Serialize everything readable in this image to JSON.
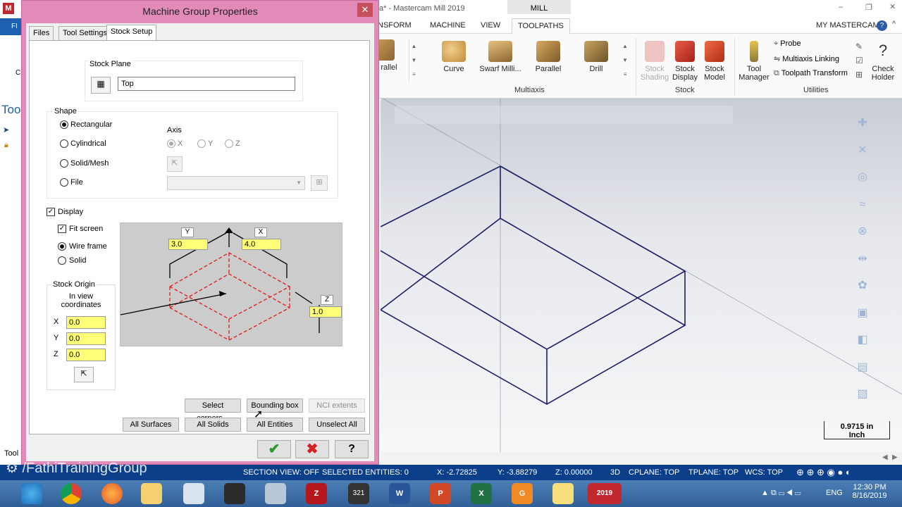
{
  "app": {
    "title_partial": "a* - Mastercam Mill 2019",
    "context_tab": "MILL",
    "my_mastercam": "MY MASTERCAM",
    "ribbon_tabs": [
      "NSFORM",
      "MACHINE",
      "VIEW",
      "TOOLPATHS"
    ],
    "active_ribbon_tab": "TOOLPATHS",
    "ribbon": {
      "partial_left": "rallel",
      "multiaxis": [
        "Curve",
        "Swarf Milli...",
        "Parallel",
        "Drill"
      ],
      "multiaxis_group": "Multiaxis",
      "stock_shading": "Stock\nShading",
      "stock_display": "Stock\nDisplay",
      "stock_model": "Stock\nModel",
      "stock_group": "Stock",
      "tool_manager": "Tool\nManager",
      "probe": "Probe",
      "multiaxis_linking": "Multiaxis Linking",
      "toolpath_transform": "Toolpath Transform",
      "check_holder": "Check\nHolder",
      "utilities_group": "Utilities"
    },
    "left_strip": {
      "fi": "FI",
      "too": "Too",
      "c": "C",
      "tool": "Tool"
    },
    "scale": {
      "value": "0.9715 in",
      "unit": "Inch"
    },
    "colors": {
      "wire": "#1a1f6b",
      "status": "#0b3f8a",
      "dialog_frame": "#e28bb9"
    }
  },
  "dialog": {
    "title": "Machine Group Properties",
    "tabs": [
      "Files",
      "Tool Settings",
      "Stock Setup"
    ],
    "active_tab": "Stock Setup",
    "stock_plane": {
      "label": "Stock Plane",
      "value": "Top"
    },
    "shape": {
      "label": "Shape",
      "options": [
        "Rectangular",
        "Cylindrical",
        "Solid/Mesh",
        "File"
      ],
      "selected": "Rectangular",
      "axis_label": "Axis",
      "axes": [
        "X",
        "Y",
        "Z"
      ],
      "axis_selected": "X"
    },
    "display": {
      "label": "Display",
      "checked": true,
      "fit_screen": "Fit screen",
      "fit_checked": true,
      "wire_frame": "Wire frame",
      "solid": "Solid",
      "selected": "Wire frame"
    },
    "stock_origin": {
      "label": "Stock Origin",
      "sub": "In view coordinates",
      "x_label": "X",
      "y_label": "Y",
      "z_label": "Z",
      "x": "0.0",
      "y": "0.0",
      "z": "0.0"
    },
    "dimensions": {
      "y_label": "Y",
      "x_label": "X",
      "z_label": "Z",
      "y": "3.0",
      "x": "4.0",
      "z": "1.0"
    },
    "buttons": {
      "select_corners": "Select corners...",
      "bounding_box": "Bounding box",
      "nci_extents": "NCI extents",
      "all_surfaces": "All Surfaces",
      "all_solids": "All Solids",
      "all_entities": "All Entities",
      "unselect_all": "Unselect All"
    },
    "footer": {
      "ok": "✔",
      "cancel": "✖",
      "help": "?"
    }
  },
  "status": {
    "watermark": "/FathiTrainingGroup",
    "section_view": "SECTION VIEW: OFF",
    "selected": "SELECTED ENTITIES: 0",
    "x": "X:   -2.72825",
    "y": "Y:   -3.88279",
    "z": "Z:   0.00000",
    "mode": "3D",
    "cplane": "CPLANE: TOP",
    "tplane": "TPLANE: TOP",
    "wcs": "WCS: TOP"
  },
  "taskbar": {
    "lang": "ENG",
    "time": "12:30 PM",
    "date": "8/16/2019"
  }
}
